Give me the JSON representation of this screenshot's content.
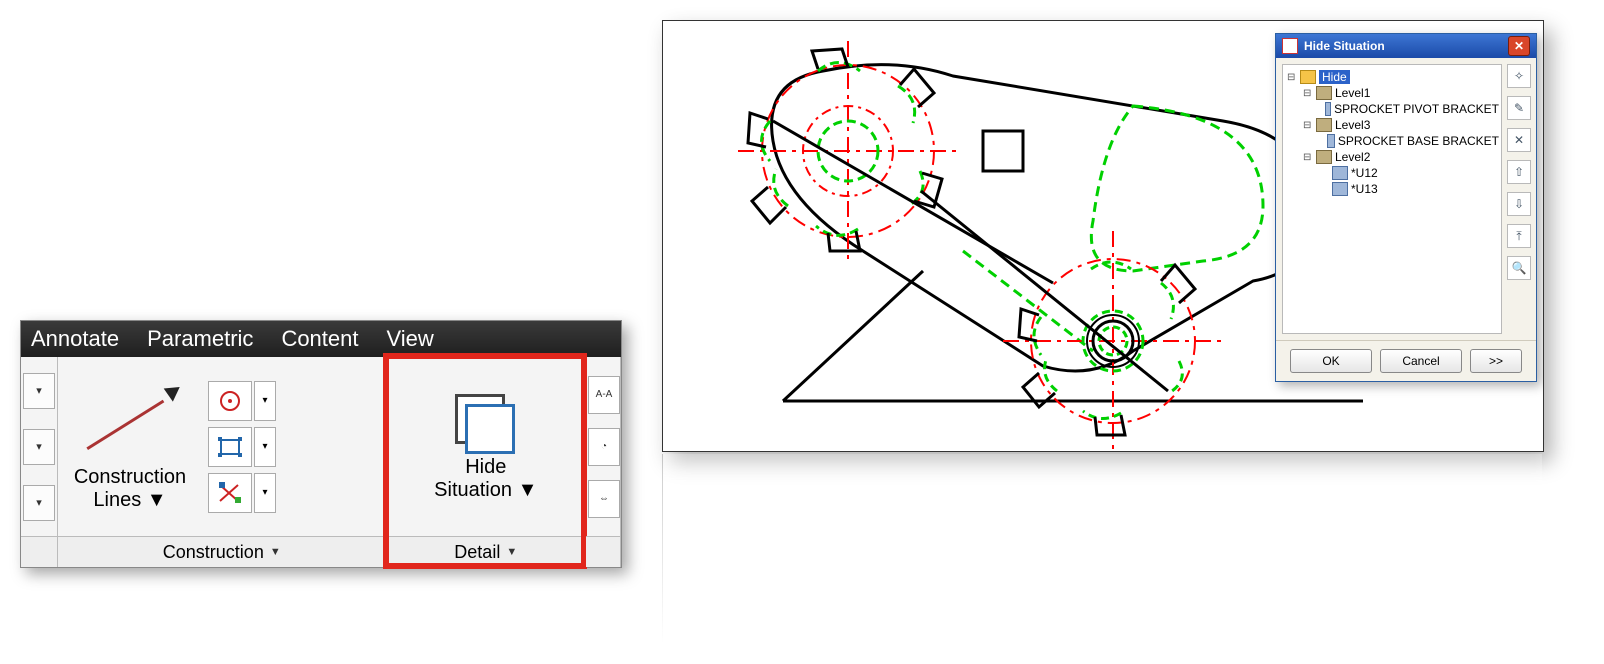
{
  "ribbon": {
    "tabs": [
      "Annotate",
      "Parametric",
      "Content",
      "View"
    ],
    "panels": {
      "construction": {
        "title": "Construction",
        "button_label_l1": "Construction",
        "button_label_l2": "Lines"
      },
      "detail": {
        "title": "Detail",
        "button_label_l1": "Hide",
        "button_label_l2": "Situation"
      }
    },
    "mini_icons": [
      "center-mark-icon",
      "assoc-rect-icon",
      "assoc-erase-icon"
    ],
    "frag_icons": [
      "section-line-icon",
      "detail-circle-icon",
      "break-icon"
    ]
  },
  "dialog": {
    "title": "Hide Situation",
    "root": "Hide",
    "levels": [
      {
        "name": "Level1",
        "children": [
          "SPROCKET PIVOT BRACKET"
        ]
      },
      {
        "name": "Level3",
        "children": [
          "SPROCKET BASE BRACKET"
        ]
      },
      {
        "name": "Level2",
        "children": [
          "*U12",
          "*U13"
        ]
      }
    ],
    "tools": [
      "new-level-icon",
      "edit-icon",
      "delete-icon",
      "move-up-icon",
      "move-down-icon",
      "move-top-icon",
      "zoom-extents-icon"
    ],
    "buttons": {
      "ok": "OK",
      "cancel": "Cancel",
      "expand": ">>"
    }
  }
}
